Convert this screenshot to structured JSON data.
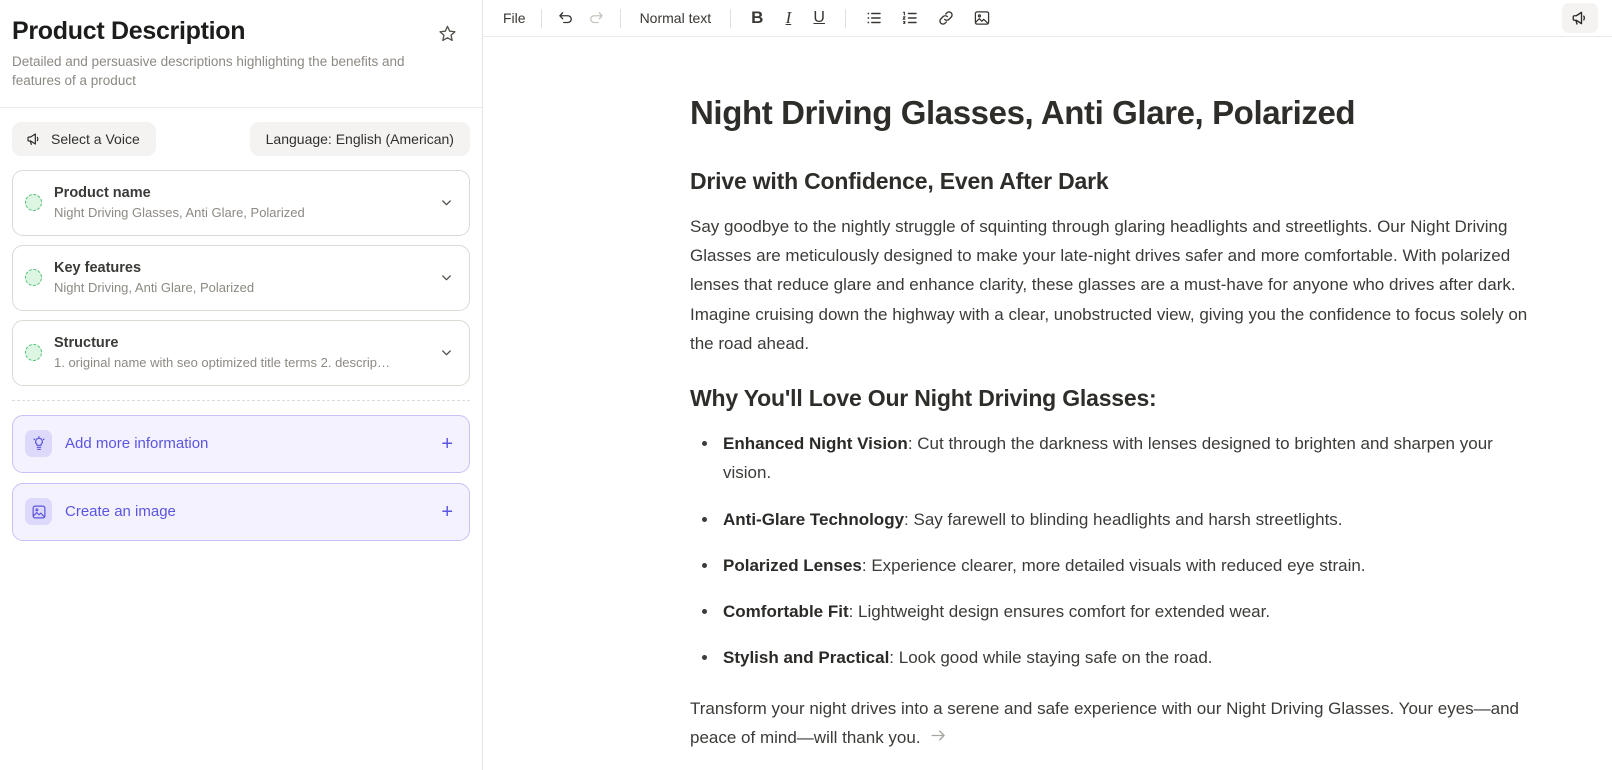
{
  "sidebar": {
    "title": "Product Description",
    "subtitle": "Detailed and persuasive descriptions highlighting the benefits and features of a product",
    "star_icon": "star-icon",
    "voice_button": "Select a Voice",
    "voice_icon": "megaphone-icon",
    "language_button": "Language: English (American)",
    "cards": [
      {
        "title": "Product name",
        "value": "Night Driving Glasses, Anti Glare, Polarized",
        "status_icon": "green-dashed-dot-icon",
        "expand_icon": "chevron-down-icon"
      },
      {
        "title": "Key features",
        "value": "Night Driving, Anti Glare, Polarized",
        "status_icon": "green-dashed-dot-icon",
        "expand_icon": "chevron-down-icon"
      },
      {
        "title": "Structure",
        "value": "1. original name with seo optimized title terms 2. descrip…",
        "status_icon": "green-dashed-dot-icon",
        "expand_icon": "chevron-down-icon"
      }
    ],
    "actions": [
      {
        "label": "Add more information",
        "icon": "lightbulb-icon",
        "plus": "+"
      },
      {
        "label": "Create an image",
        "icon": "image-icon",
        "plus": "+"
      }
    ],
    "colors": {
      "accent_purple": "#5b55e0",
      "accent_purple_bg": "#f3f2fe",
      "accent_purple_border": "#c7c2f5",
      "status_green": "#4fbf74",
      "status_green_bg": "#ddf6e3",
      "pill_bg": "#f4f3f1",
      "border": "#ddd9d3"
    }
  },
  "toolbar": {
    "file_label": "File",
    "undo_icon": "undo-icon",
    "redo_icon": "redo-icon",
    "text_style": "Normal text",
    "bold_label": "B",
    "italic_label": "I",
    "underline_label": "U",
    "bullet_list_icon": "bullet-list-icon",
    "numbered_list_icon": "numbered-list-icon",
    "link_icon": "link-icon",
    "image_icon": "image-icon",
    "announce_icon": "megaphone-icon"
  },
  "document": {
    "title": "Night Driving Glasses, Anti Glare, Polarized",
    "heading1": "Drive with Confidence, Even After Dark",
    "paragraph1": "Say goodbye to the nightly struggle of squinting through glaring headlights and streetlights. Our Night Driving Glasses are meticulously designed to make your late-night drives safer and more comfortable. With polarized lenses that reduce glare and enhance clarity, these glasses are a must-have for anyone who drives after dark. Imagine cruising down the highway with a clear, unobstructed view, giving you the confidence to focus solely on the road ahead.",
    "heading2": "Why You'll Love Our Night Driving Glasses:",
    "bullets": [
      {
        "term": "Enhanced Night Vision",
        "text": ": Cut through the darkness with lenses designed to brighten and sharpen your vision."
      },
      {
        "term": "Anti-Glare Technology",
        "text": ": Say farewell to blinding headlights and harsh streetlights."
      },
      {
        "term": "Polarized Lenses",
        "text": ": Experience clearer, more detailed visuals with reduced eye strain."
      },
      {
        "term": "Comfortable Fit",
        "text": ": Lightweight design ensures comfort for extended wear."
      },
      {
        "term": "Stylish and Practical",
        "text": ": Look good while staying safe on the road."
      }
    ],
    "paragraph2": "Transform your night drives into a serene and safe experience with our Night Driving Glasses. Your eyes—and peace of mind—will thank you."
  }
}
